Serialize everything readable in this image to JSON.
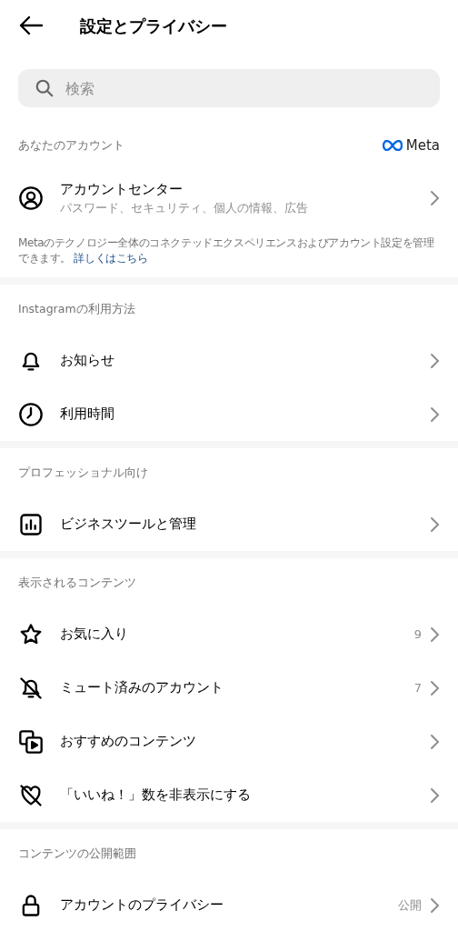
{
  "header": {
    "title": "設定とプライバシー"
  },
  "search": {
    "placeholder": "検索"
  },
  "sections": [
    {
      "title": "あなたのアカウント",
      "brand": "Meta",
      "items": [
        {
          "label": "アカウントセンター",
          "subtitle": "パスワード、セキュリティ、個人の情報、広告"
        }
      ],
      "note": "Metaのテクノロジー全体のコネクテッドエクスペリエンスおよびアカウント設定を管理できます。",
      "note_link": "詳しくはこちら"
    },
    {
      "title": "Instagramの利用方法",
      "items": [
        {
          "label": "お知らせ"
        },
        {
          "label": "利用時間"
        }
      ]
    },
    {
      "title": "プロフェッショナル向け",
      "items": [
        {
          "label": "ビジネスツールと管理"
        }
      ]
    },
    {
      "title": "表示されるコンテンツ",
      "items": [
        {
          "label": "お気に入り",
          "count": "9"
        },
        {
          "label": "ミュート済みのアカウント",
          "count": "7"
        },
        {
          "label": "おすすめのコンテンツ"
        },
        {
          "label": "「いいね！」数を非表示にする"
        }
      ]
    },
    {
      "title": "コンテンツの公開範囲",
      "items": [
        {
          "label": "アカウントのプライバシー",
          "count": "公開"
        }
      ]
    }
  ]
}
